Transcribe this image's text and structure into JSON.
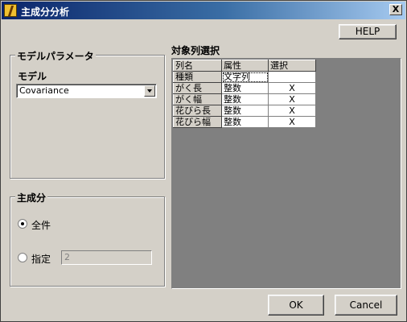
{
  "window": {
    "title": "主成分分析",
    "close_label": "X"
  },
  "buttons": {
    "help": "HELP",
    "ok": "OK",
    "cancel": "Cancel"
  },
  "model_params": {
    "group_title": "モデルパラメータ",
    "model_label": "モデル",
    "model_value": "Covariance"
  },
  "components": {
    "group_title": "主成分",
    "all_label": "全件",
    "all_selected": true,
    "specify_label": "指定",
    "specify_value": "2"
  },
  "target_columns": {
    "label": "対象列選択",
    "headers": [
      "列名",
      "属性",
      "選択"
    ],
    "rows": [
      {
        "name": "種類",
        "attr": "文字列",
        "select": ""
      },
      {
        "name": "がく長",
        "attr": "整数",
        "select": "X"
      },
      {
        "name": "がく幅",
        "attr": "整数",
        "select": "X"
      },
      {
        "name": "花びら長",
        "attr": "整数",
        "select": "X"
      },
      {
        "name": "花びら幅",
        "attr": "整数",
        "select": "X"
      }
    ]
  },
  "colors": {
    "face": "#d4d0c8",
    "title_start": "#0a246a",
    "title_end": "#a6caf0",
    "panel_bg": "#808080"
  }
}
